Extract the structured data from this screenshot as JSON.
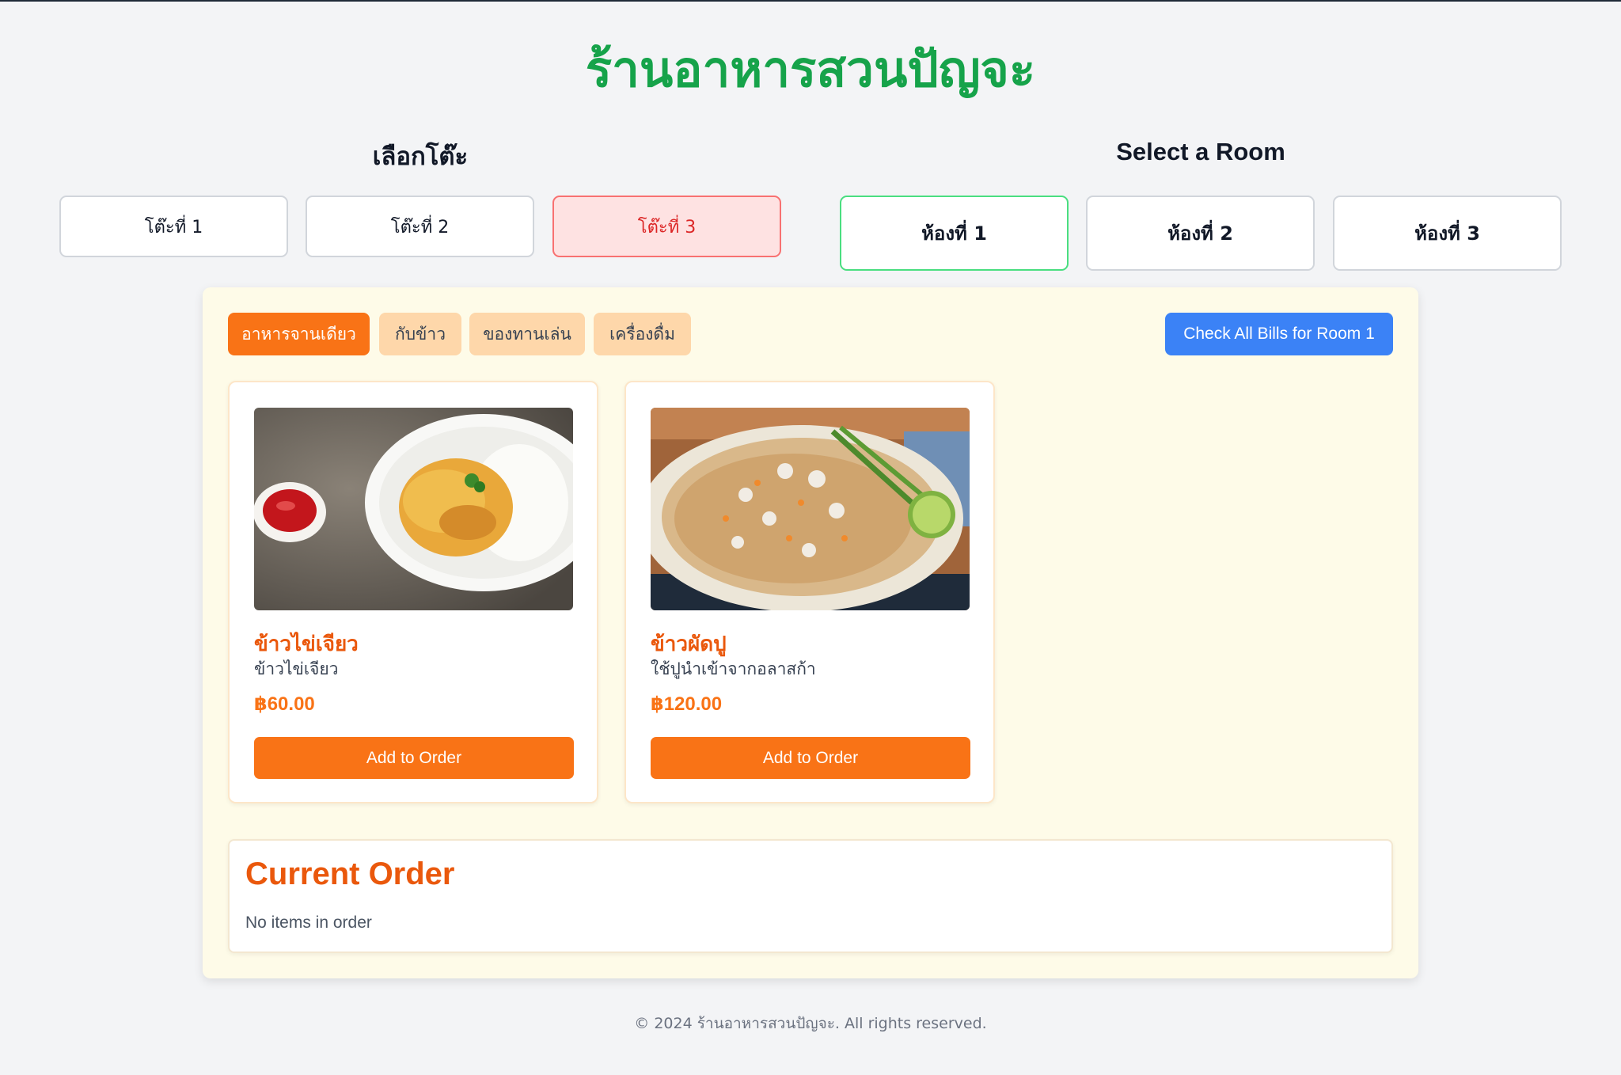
{
  "restaurant_name": "ร้านอาหารสวนปัญจะ",
  "tables": {
    "heading": "เลือกโต๊ะ",
    "items": [
      {
        "label": "โต๊ะที่ 1",
        "active": false
      },
      {
        "label": "โต๊ะที่ 2",
        "active": false
      },
      {
        "label": "โต๊ะที่ 3",
        "active": true
      }
    ]
  },
  "rooms": {
    "heading": "Select a Room",
    "items": [
      {
        "label": "ห้องที่ 1",
        "active": true
      },
      {
        "label": "ห้องที่ 2",
        "active": false
      },
      {
        "label": "ห้องที่ 3",
        "active": false
      }
    ]
  },
  "categories": [
    {
      "label": "อาหารจานเดียว",
      "active": true
    },
    {
      "label": "กับข้าว",
      "active": false
    },
    {
      "label": "ของทานเล่น",
      "active": false
    },
    {
      "label": "เครื่องดื่ม",
      "active": false
    }
  ],
  "bills_button": "Check All Bills for Room 1",
  "menu_items": [
    {
      "name": "ข้าวไข่เจียว",
      "description": "ข้าวไข่เจียว",
      "price": "฿60.00",
      "add_label": "Add to Order",
      "image": "omelette-rice-photo"
    },
    {
      "name": "ข้าวผัดปู",
      "description": "ใช้ปูนำเข้าจากอลาสก้า",
      "price": "฿120.00",
      "add_label": "Add to Order",
      "image": "crab-fried-rice-photo"
    }
  ],
  "order": {
    "title": "Current Order",
    "empty_text": "No items in order"
  },
  "footer": "© 2024 ร้านอาหารสวนปัญจะ. All rights reserved.",
  "colors": {
    "brand_green": "#16a34a",
    "accent_orange": "#f97316",
    "blue": "#3b82f6",
    "panel_bg": "#fefbe8"
  }
}
